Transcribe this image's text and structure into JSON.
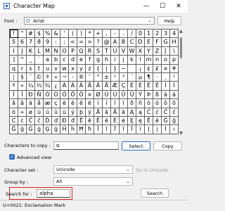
{
  "window": {
    "title": "Character Map",
    "minimize": "—",
    "maximize": "☐",
    "close": "✕"
  },
  "font_row": {
    "label": "Font :",
    "value": "Arial",
    "font_icon": "O",
    "help_label": "Help"
  },
  "chars": [
    "!",
    "\"",
    "#",
    "$",
    "%",
    "&",
    "'",
    "(",
    ")",
    "*",
    "+",
    ",",
    "-",
    ".",
    "/",
    "0",
    "1",
    "2",
    "3",
    "4",
    "5",
    "6",
    "7",
    "8",
    "9",
    ":",
    ";",
    "<",
    "=",
    ">",
    "?",
    "@",
    "A",
    "B",
    "C",
    "D",
    "E",
    "F",
    "G",
    "H",
    "I",
    "J",
    "K",
    "L",
    "M",
    "N",
    "O",
    "P",
    "Q",
    "R",
    "S",
    "T",
    "U",
    "V",
    "W",
    "X",
    "Y",
    "Z",
    "[",
    "\\",
    "]",
    "^",
    "_",
    "`",
    "a",
    "b",
    "c",
    "d",
    "e",
    "f",
    "g",
    "h",
    "i",
    "j",
    "k",
    "l",
    "m",
    "n",
    "o",
    "p",
    "q",
    "r",
    "s",
    "t",
    "u",
    "v",
    "w",
    "x",
    "y",
    "z",
    "{",
    "|",
    "}",
    "~",
    " ",
    "¡",
    "¢",
    "£",
    "¤",
    "¥",
    "¦",
    "§",
    "¨",
    "©",
    "ª",
    "«",
    "¬",
    "-",
    "®",
    "¯",
    "°",
    "±",
    "²",
    "³",
    "´",
    "µ",
    "¶",
    "·",
    "¸",
    "¹",
    "º",
    "»",
    "¼",
    "½",
    "¾",
    "¿",
    "À",
    "Á",
    "Â",
    "Ã",
    "Ä",
    "Å",
    "Æ",
    "Ç",
    "È",
    "É",
    "Ê",
    "Ë",
    "Ì",
    "Í",
    "Î",
    "Ï",
    "Ð",
    "Ñ",
    "Ò",
    "Ó",
    "Ô",
    "Õ",
    "Ö",
    "×",
    "Ø",
    "Ù",
    "Ú",
    "Û",
    "Ü",
    "Ý",
    "Þ",
    "ß",
    "à",
    "á",
    "â",
    "ã",
    "ä",
    "å",
    "æ",
    "ç",
    "è",
    "é",
    "ê",
    "ë",
    "ì",
    "í",
    "î",
    "ï",
    "ð",
    "ñ",
    "ò",
    "ó",
    "ô",
    "õ",
    "ö",
    "÷",
    "ø",
    "ù",
    "ú",
    "û",
    "ü",
    "ý",
    "þ",
    "ÿ",
    "Ā",
    "ā",
    "Ă",
    "ă",
    "Ą",
    "ą",
    "Ć",
    "ć",
    "Ĉ",
    "ĉ",
    "Ċ",
    "ċ",
    "Č",
    "č",
    "Ď",
    "ď",
    "Đ",
    "đ",
    "Ē",
    "ē",
    "Ĕ",
    "ĕ",
    "Ė",
    "ė",
    "Ę",
    "ę",
    "Ě",
    "ě",
    "Ĝ",
    "ĝ",
    "Ğ",
    "ğ",
    "Ġ",
    "ġ",
    "Ģ",
    "ģ",
    "Ĥ",
    "ĥ",
    "Ħ",
    "ħ",
    "Ĩ",
    "ĩ",
    "Ī",
    "ī",
    "Ĭ",
    "ĭ",
    "Į",
    "į",
    "İ",
    "ı"
  ],
  "copy_row": {
    "label": "Characters to copy :",
    "value": "α",
    "select_label": "Select",
    "copy_label": "Copy"
  },
  "advanced": {
    "label": "Advanced view",
    "checked": "✓"
  },
  "character_set": {
    "label": "Character set :",
    "value": "Unicode",
    "goto_label": "Go to Unicode :"
  },
  "group_by": {
    "label": "Group by :",
    "value": "All"
  },
  "search": {
    "label": "Search for :",
    "value": "alpha",
    "button": "Search"
  },
  "status": "U+0021: Exclamation Mark"
}
